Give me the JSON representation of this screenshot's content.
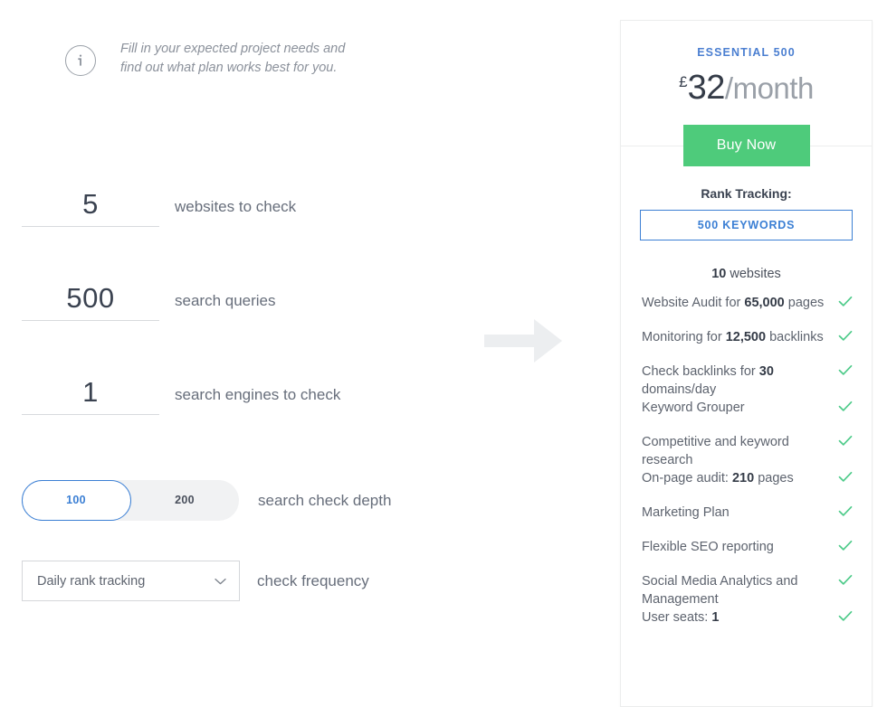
{
  "intro": {
    "icon": "info-circle-icon",
    "text": "Fill in your expected project needs and find out what plan works best for you."
  },
  "calculator": {
    "fields": [
      {
        "value": "5",
        "label": "websites to check"
      },
      {
        "value": "500",
        "label": "search queries"
      },
      {
        "value": "1",
        "label": "search engines to check"
      }
    ],
    "depth": {
      "label": "search check depth",
      "options": [
        "100",
        "200"
      ],
      "selected": "100"
    },
    "frequency": {
      "label": "check frequency",
      "value": "Daily rank tracking",
      "chevron": "chevron-down-icon"
    },
    "arrow_icon": "arrow-right-icon"
  },
  "plan": {
    "name": "ESSENTIAL 500",
    "currency": "£",
    "amount": "32",
    "period": "/month",
    "buy_label": "Buy Now",
    "rank_tracking_title": "Rank Tracking:",
    "keywords_label": "500 KEYWORDS",
    "websites_count": "10",
    "websites_suffix": " websites",
    "features": [
      {
        "pre": "Website Audit for ",
        "strong": "65,000",
        "post": " pages",
        "check": true
      },
      {
        "pre": "Monitoring for ",
        "strong": "12,500",
        "post": " backlinks",
        "check": true
      },
      {
        "pre": "Check backlinks for ",
        "strong": "30",
        "post": " domains/day",
        "check": true
      },
      {
        "pre": "Keyword Grouper",
        "strong": "",
        "post": "",
        "check": true
      },
      {
        "pre": "Competitive and keyword research",
        "strong": "",
        "post": "",
        "check": true
      },
      {
        "pre": "On-page audit: ",
        "strong": "210",
        "post": " pages",
        "check": true
      },
      {
        "pre": "Marketing Plan",
        "strong": "",
        "post": "",
        "check": true
      },
      {
        "pre": "Flexible SEO reporting",
        "strong": "",
        "post": "",
        "check": true
      },
      {
        "pre": "Social Media Analytics and Management",
        "strong": "",
        "post": "",
        "check": true
      },
      {
        "pre": "User seats: ",
        "strong": "1",
        "post": "",
        "check": true
      }
    ]
  },
  "colors": {
    "accent_blue": "#3b7fd4",
    "buy_green": "#4ecb7b",
    "check_green": "#4ecb8a",
    "text_dark": "#343b47",
    "text_muted": "#8b919b",
    "arrow_gray": "#eceef0"
  }
}
